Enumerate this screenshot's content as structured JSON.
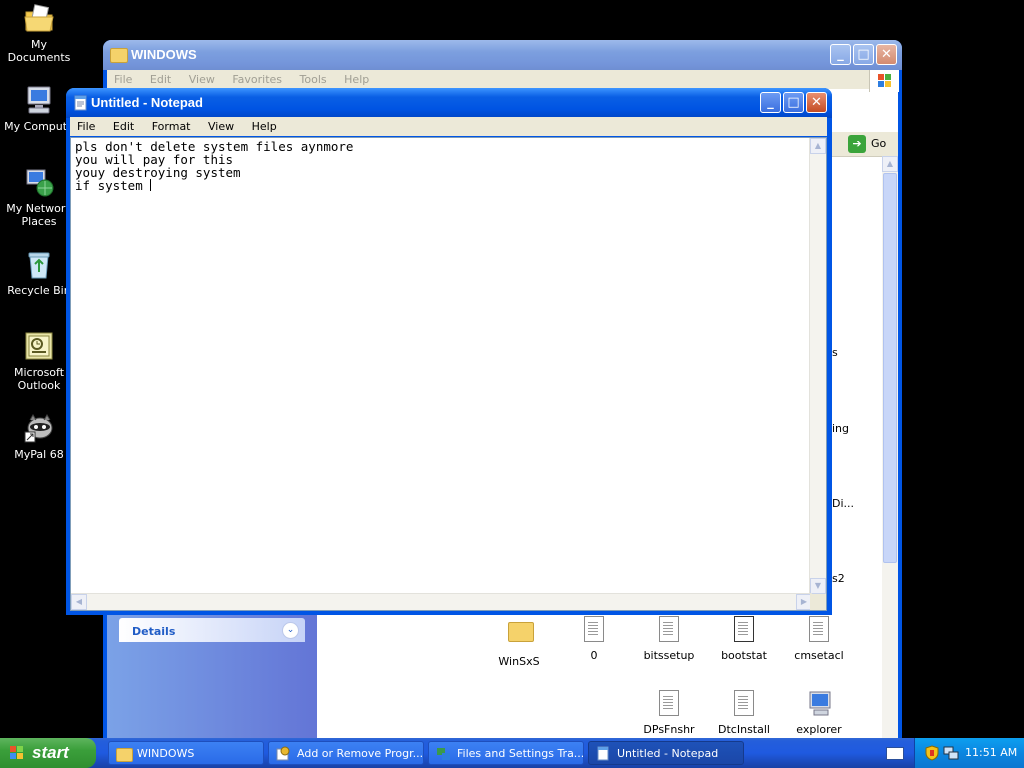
{
  "desktop": {
    "icons": [
      {
        "label": "My Documents"
      },
      {
        "label": "My Compute"
      },
      {
        "label": "My Network Places"
      },
      {
        "label": "Recycle Bin"
      },
      {
        "label": "Microsoft Outlook"
      },
      {
        "label": "MyPal 68"
      }
    ]
  },
  "explorer": {
    "title": "WINDOWS",
    "menu": [
      "File",
      "Edit",
      "View",
      "Favorites",
      "Tools",
      "Help"
    ],
    "go_label": "Go",
    "details_label": "Details",
    "partial_labels": [
      "s",
      "ing",
      "Di...",
      "s2"
    ],
    "files": [
      {
        "name": "WinSxS",
        "kind": "folder"
      },
      {
        "name": "0",
        "kind": "doc"
      },
      {
        "name": "bitssetup",
        "kind": "doc"
      },
      {
        "name": "bootstat",
        "kind": "doc"
      },
      {
        "name": "cmsetacl",
        "kind": "doc"
      },
      {
        "name": "DPsFnshr",
        "kind": "doc"
      },
      {
        "name": "DtcInstall",
        "kind": "doc"
      },
      {
        "name": "explorer",
        "kind": "app"
      }
    ]
  },
  "notepad": {
    "title": "Untitled - Notepad",
    "menu": [
      "File",
      "Edit",
      "Format",
      "View",
      "Help"
    ],
    "text_lines": [
      "pls don't delete system files aynmore",
      "you will pay for this",
      "youy destroying system",
      "if system "
    ]
  },
  "taskbar": {
    "start_label": "start",
    "items": [
      {
        "label": "WINDOWS"
      },
      {
        "label": "Add or Remove Progr..."
      },
      {
        "label": "Files and Settings Tra..."
      },
      {
        "label": "Untitled - Notepad"
      }
    ],
    "clock": "11:51 AM"
  },
  "colors": {
    "accent": "#0054e3",
    "taskbar": "#245edb",
    "start": "#3b9f3b"
  }
}
